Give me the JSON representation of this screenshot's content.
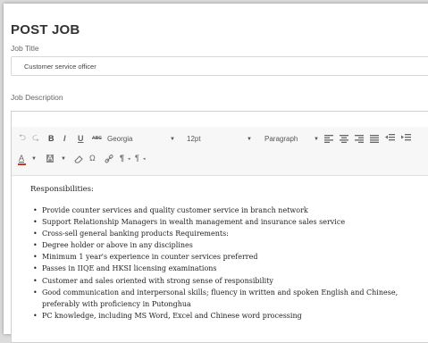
{
  "page": {
    "title": "POST JOB"
  },
  "job_title": {
    "label": "Job Title",
    "value": "Customer service officer"
  },
  "job_description": {
    "label": "Job Description"
  },
  "editor": {
    "menubar_end": "V",
    "toolbar": {
      "undo": "⮌",
      "redo": "⮎",
      "bold": "B",
      "italic": "I",
      "underline": "U",
      "strike": "ABC",
      "font_family": "Georgia",
      "font_size": "12pt",
      "block_format": "Paragraph",
      "text_color": "A",
      "bg_color": "A",
      "eraser": "⌫",
      "omega": "Ω",
      "link": "🔗",
      "ltr": "¶",
      "rtl": "¶"
    },
    "content": {
      "heading": "Responsibilities:",
      "items": [
        "Provide counter services and quality customer service in branch network",
        "Support Relationship Managers in wealth management and insurance sales service",
        "Cross-sell general banking products Requirements:",
        "Degree holder or above in any disciplines",
        "Minimum 1 year's experience in counter services preferred",
        "Passes in IIQE and HKSI licensing examinations",
        "Customer and sales oriented with strong sense of responsibility",
        "Good communication and interpersonal skills; fluency in written and spoken English and Chinese, preferably with proficiency in Putonghua",
        "PC knowledge, including MS Word, Excel and Chinese word processing"
      ]
    }
  }
}
